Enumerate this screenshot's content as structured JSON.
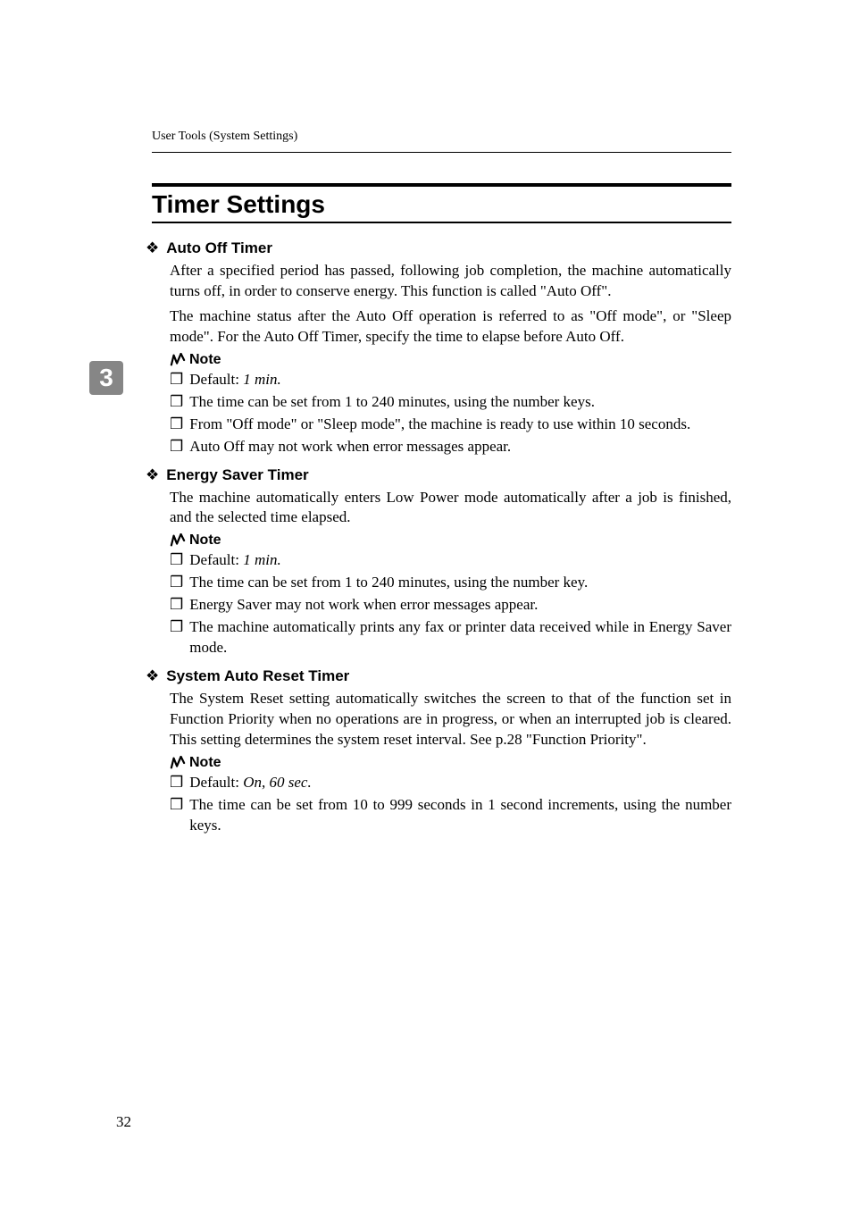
{
  "header": {
    "running_title": "User Tools (System Settings)"
  },
  "chapter_number": "3",
  "section_title": "Timer Settings",
  "items": [
    {
      "title": "Auto Off Timer",
      "desc_parts": [
        "After a specified period has passed, following job completion, the machine automatically turns off, in order to conserve energy. This function is called \"Auto Off\".",
        "The machine status after the Auto Off operation is referred to as \"Off mode\", or \"Sleep mode\". For the Auto Off Timer, specify the time to elapse before Auto Off."
      ],
      "note_label": "Note",
      "notes": [
        {
          "prefix": "Default: ",
          "italic": "1 min."
        },
        {
          "text": "The time can be set from 1 to 240 minutes, using the number keys."
        },
        {
          "text": "From \"Off mode\" or \"Sleep mode\", the machine is ready to use within 10 seconds."
        },
        {
          "text": "Auto Off may not work when error messages appear."
        }
      ]
    },
    {
      "title": "Energy Saver Timer",
      "desc_parts": [
        "The machine automatically enters Low Power mode automatically after a job is finished, and the selected time elapsed."
      ],
      "note_label": "Note",
      "notes": [
        {
          "prefix": "Default: ",
          "italic": "1 min."
        },
        {
          "text": "The time can be set from 1 to 240 minutes, using the number key."
        },
        {
          "text": "Energy Saver may not work when error messages appear."
        },
        {
          "text": "The machine automatically prints any fax or printer data received while in Energy Saver mode."
        }
      ]
    },
    {
      "title": "System Auto Reset Timer",
      "desc_parts": [
        "The System Reset setting automatically switches the screen to that of the function set in Function Priority when no operations are in progress, or when an interrupted job is cleared. This setting determines the system reset interval. See p.28 \"Function Priority\"."
      ],
      "note_label": "Note",
      "notes": [
        {
          "prefix": "Default: ",
          "italic": "On",
          "suffix": ", ",
          "italic2": "60 sec."
        },
        {
          "text": "The time can be set from 10 to 999 seconds in 1 second increments, using the number keys."
        }
      ]
    }
  ],
  "page_number": "32"
}
